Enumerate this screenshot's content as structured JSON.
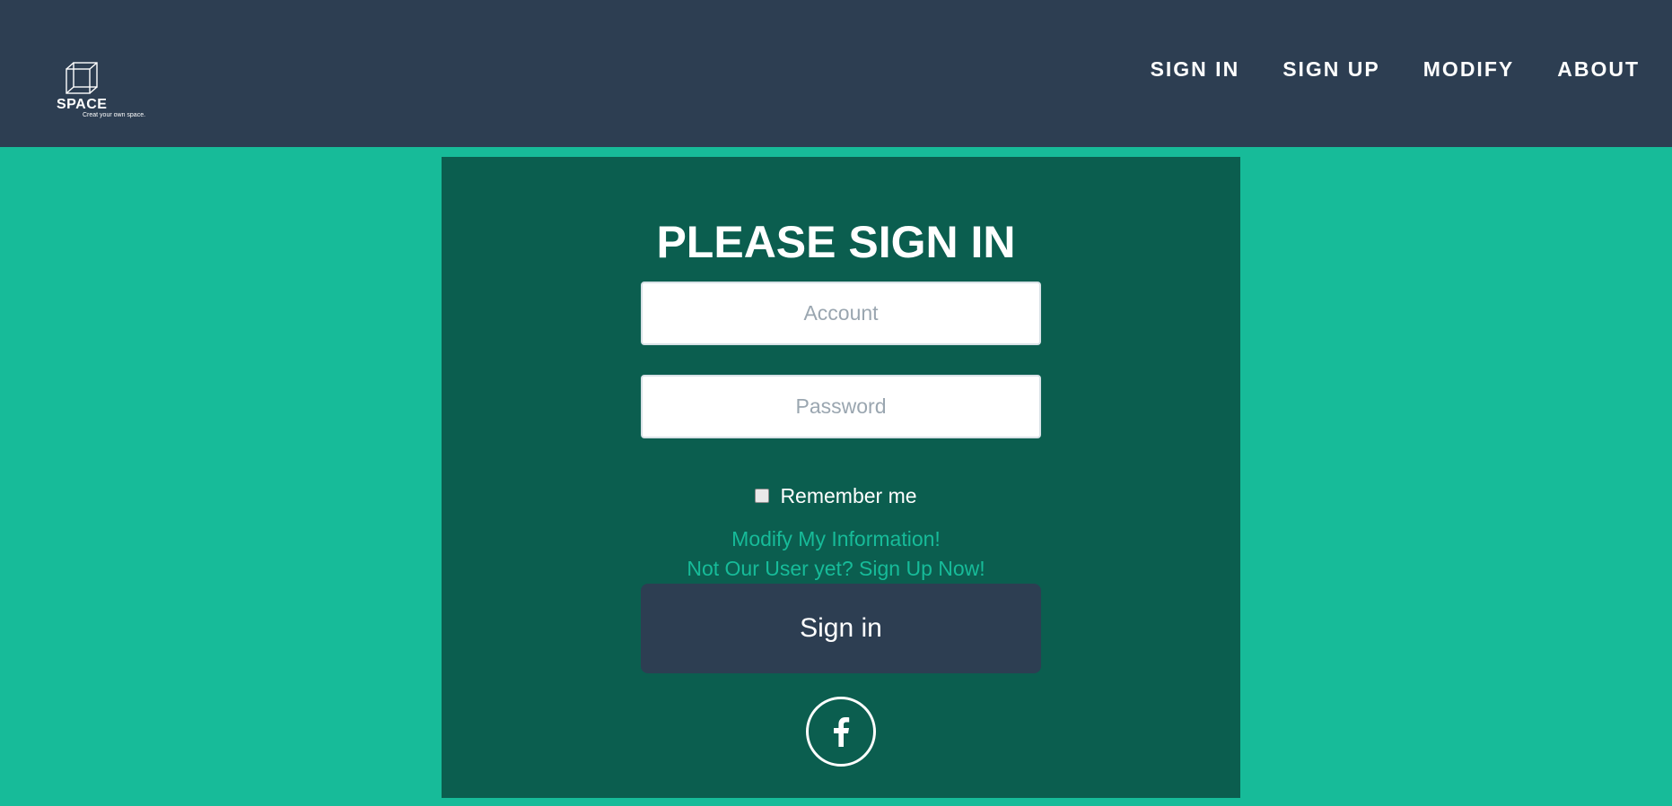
{
  "header": {
    "logo": {
      "name": "SPACE",
      "tagline": "Creat your own space."
    },
    "nav": [
      {
        "label": "SIGN IN"
      },
      {
        "label": "SIGN UP"
      },
      {
        "label": "MODIFY"
      },
      {
        "label": "ABOUT"
      }
    ]
  },
  "form": {
    "title": "PLEASE SIGN IN",
    "account_placeholder": "Account",
    "password_placeholder": "Password",
    "remember_label": "Remember me",
    "modify_link": "Modify My Information!",
    "signup_link": "Not Our User yet? Sign Up Now!",
    "submit_label": "Sign in",
    "social_icon": "facebook-icon"
  },
  "colors": {
    "header_bg": "#2d3e52",
    "page_bg": "#17bb99",
    "panel_bg": "#0b5e4f",
    "link": "#17bb99",
    "button_bg": "#2d3e52"
  }
}
